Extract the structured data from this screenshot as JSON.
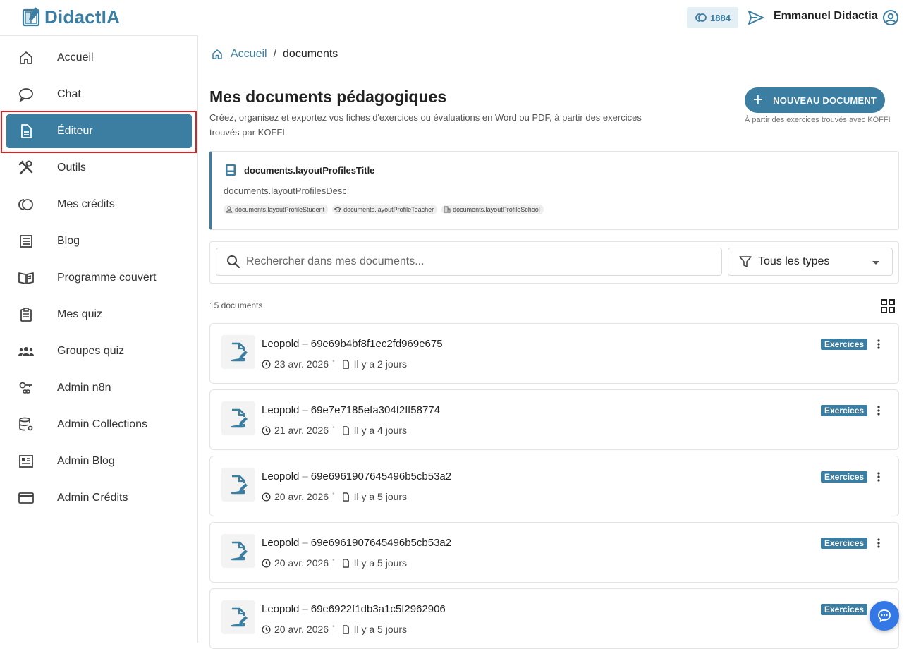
{
  "app": {
    "name": "DidactIA",
    "credits": "1884",
    "user_name": "Emmanuel Didactia"
  },
  "sidebar": {
    "items": [
      {
        "label": "Accueil",
        "icon": "home-icon"
      },
      {
        "label": "Chat",
        "icon": "chat-bubble-icon"
      },
      {
        "label": "Éditeur",
        "icon": "document-icon",
        "active": true
      },
      {
        "label": "Outils",
        "icon": "tools-icon"
      },
      {
        "label": "Mes crédits",
        "icon": "credits-icon"
      },
      {
        "label": "Blog",
        "icon": "blog-icon"
      },
      {
        "label": "Programme couvert",
        "icon": "open-book-icon"
      },
      {
        "label": "Mes quiz",
        "icon": "clipboard-icon"
      },
      {
        "label": "Groupes quiz",
        "icon": "groups-icon"
      },
      {
        "label": "Admin n8n",
        "icon": "key-link-icon"
      },
      {
        "label": "Admin Collections",
        "icon": "database-gear-icon"
      },
      {
        "label": "Admin Blog",
        "icon": "newspaper-icon"
      },
      {
        "label": "Admin Crédits",
        "icon": "credit-card-icon"
      }
    ]
  },
  "breadcrumb": {
    "home": "Accueil",
    "separator": "/",
    "current": "documents"
  },
  "page": {
    "title": "Mes documents pédagogiques",
    "subtitle": "Créez, organisez et exportez vos fiches d'exercices ou évaluations en Word ou PDF, à partir des exercices trouvés par KOFFI.",
    "new_button": "NOUVEAU DOCUMENT",
    "new_hint": "À partir des exercices trouvés avec KOFFI"
  },
  "profiles": {
    "title": "documents.layoutProfilesTitle",
    "desc": "documents.layoutProfilesDesc",
    "chips": [
      "documents.layoutProfileStudent",
      "documents.layoutProfileTeacher",
      "documents.layoutProfileSchool"
    ]
  },
  "filters": {
    "search_placeholder": "Rechercher dans mes documents...",
    "type_value": "Tous les types"
  },
  "list": {
    "count_label": "15 documents",
    "documents": [
      {
        "owner": "Leopold",
        "id": "69e69b4bf8f1ec2fd969e675",
        "date": "23 avr. 2026",
        "ago": "Il y a 2 jours",
        "badge": "Exercices"
      },
      {
        "owner": "Leopold",
        "id": "69e7e7185efa304f2ff58774",
        "date": "21 avr. 2026",
        "ago": "Il y a 4 jours",
        "badge": "Exercices"
      },
      {
        "owner": "Leopold",
        "id": "69e6961907645496b5cb53a2",
        "date": "20 avr. 2026",
        "ago": "Il y a 5 jours",
        "badge": "Exercices"
      },
      {
        "owner": "Leopold",
        "id": "69e6961907645496b5cb53a2",
        "date": "20 avr. 2026",
        "ago": "Il y a 5 jours",
        "badge": "Exercices"
      },
      {
        "owner": "Leopold",
        "id": "69e6922f1db3a1c5f2962906",
        "date": "20 avr. 2026",
        "ago": "Il y a 5 jours",
        "badge": "Exercices"
      }
    ]
  },
  "colors": {
    "accent": "#3b7ea1",
    "highlight": "#e02020",
    "fab": "#3478e6"
  }
}
